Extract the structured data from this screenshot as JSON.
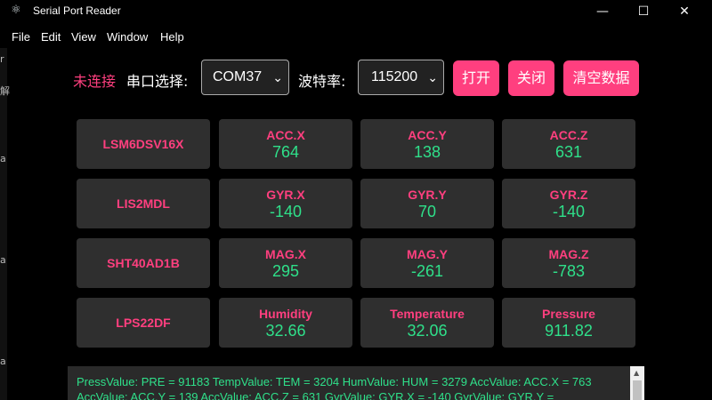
{
  "window": {
    "title": "Serial Port Reader",
    "icon": "electron-icon"
  },
  "window_controls": {
    "minimize": "—",
    "maximize": "☐",
    "close": "✕"
  },
  "menu": [
    "File",
    "Edit",
    "View",
    "Window",
    "Help"
  ],
  "controls": {
    "status": "未连接",
    "port_label": "串口选择:",
    "port_value": "COM37",
    "baud_label": "波特率:",
    "baud_value": "115200",
    "open_button": "打开",
    "close_button": "关闭",
    "clear_button": "清空数据"
  },
  "colors": {
    "accent": "#ff3f7f",
    "value": "#2fe08a",
    "card": "#2f2f2f"
  },
  "sensors": [
    {
      "name": "LSM6DSV16X",
      "readings": [
        {
          "label": "ACC.X",
          "value": "764"
        },
        {
          "label": "ACC.Y",
          "value": "138"
        },
        {
          "label": "ACC.Z",
          "value": "631"
        }
      ]
    },
    {
      "name": "LIS2MDL",
      "readings": [
        {
          "label": "GYR.X",
          "value": "-140"
        },
        {
          "label": "GYR.Y",
          "value": "70"
        },
        {
          "label": "GYR.Z",
          "value": "-140"
        }
      ]
    },
    {
      "name": "SHT40AD1B",
      "readings": [
        {
          "label": "MAG.X",
          "value": "295"
        },
        {
          "label": "MAG.Y",
          "value": "-261"
        },
        {
          "label": "MAG.Z",
          "value": "-783"
        }
      ]
    },
    {
      "name": "LPS22DF",
      "readings": [
        {
          "label": "Humidity",
          "value": "32.66"
        },
        {
          "label": "Temperature",
          "value": "32.06"
        },
        {
          "label": "Pressure",
          "value": "911.82"
        }
      ]
    }
  ],
  "log": {
    "text": "PressValue: PRE = 91183 TempValue: TEM = 3204 HumValue: HUM = 3279 AccValue: ACC.X = 763 AccValue: ACC.Y = 139 AccValue: ACC.Z = 631 GyrValue: GYR.X = -140 GyrValue: GYR.Y ="
  }
}
